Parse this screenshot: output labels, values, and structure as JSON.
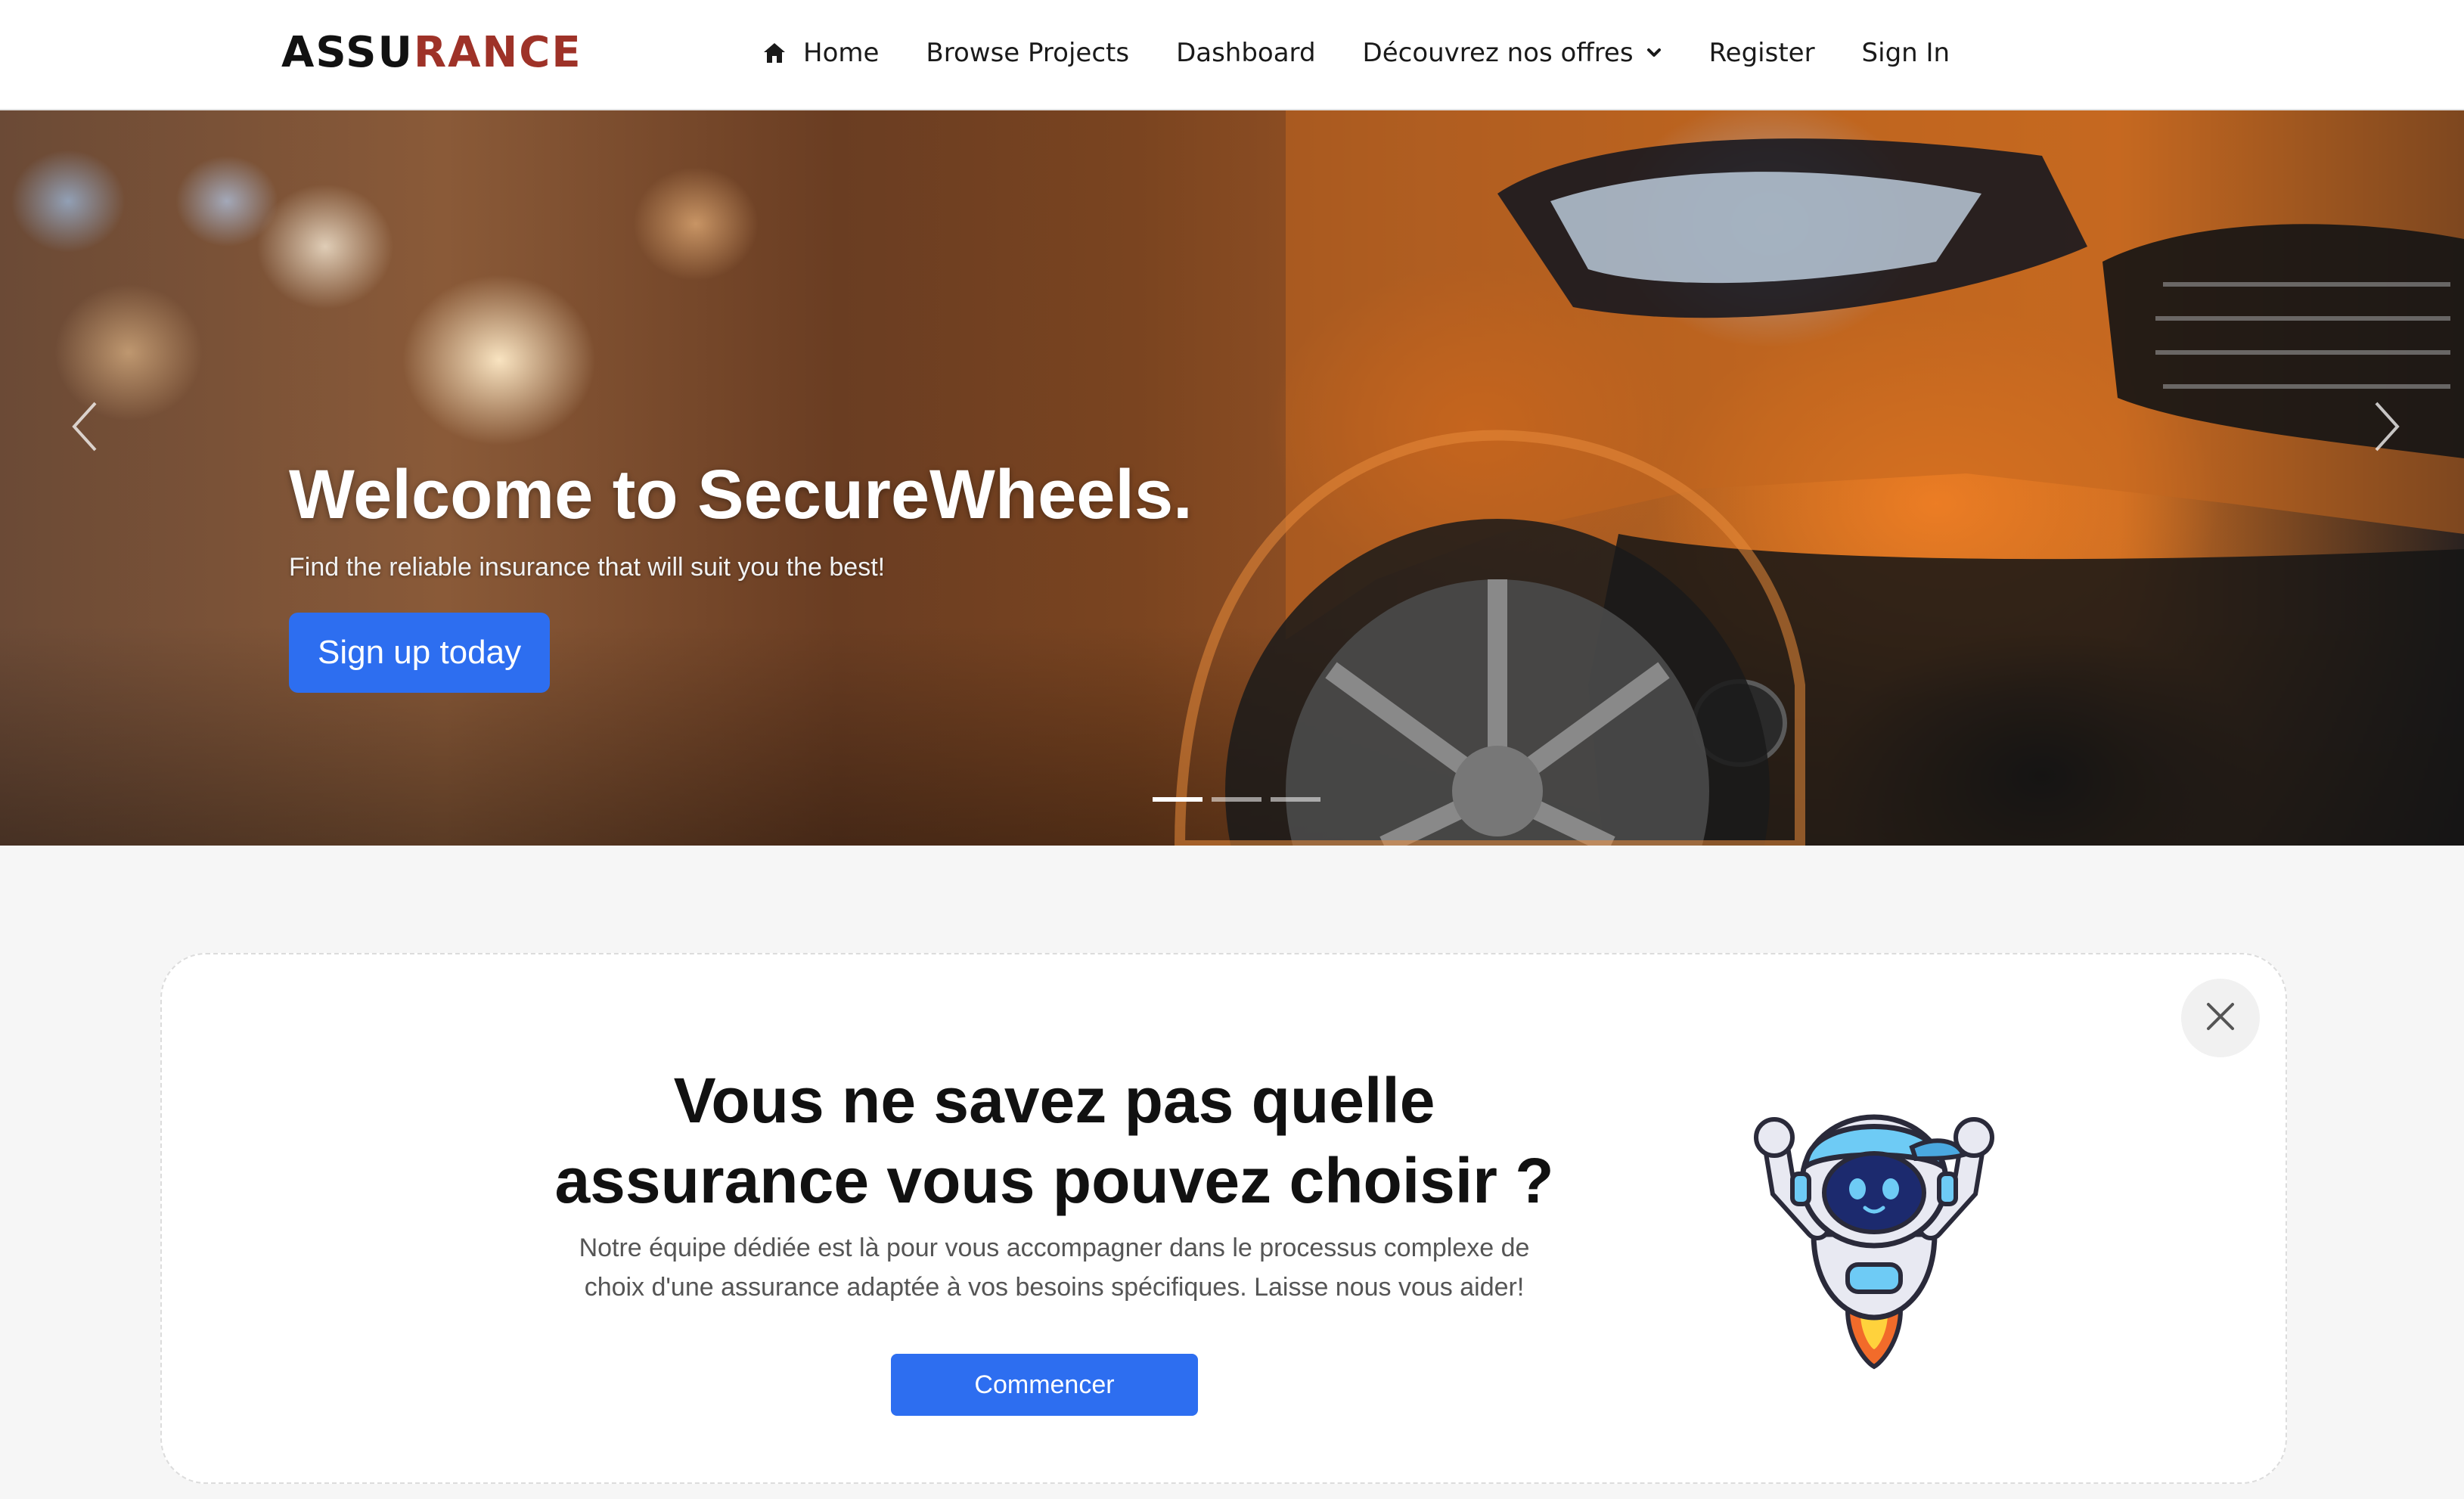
{
  "brand": {
    "part1": "ASSU",
    "part2": "RANCE",
    "color_primary": "#111111",
    "color_accent": "#9e3228"
  },
  "nav": {
    "items": [
      {
        "label": "Home",
        "icon": "home-icon"
      },
      {
        "label": "Browse Projects"
      },
      {
        "label": "Dashboard"
      },
      {
        "label": "Découvrez nos offres",
        "icon": "chevron-down-icon"
      },
      {
        "label": "Register"
      },
      {
        "label": "Sign In"
      }
    ]
  },
  "hero": {
    "title": "Welcome to SecureWheels.",
    "subtitle": "Find the reliable insurance that will suit you the best!",
    "cta_label": "Sign up today",
    "prev_icon": "chevron-left-icon",
    "next_icon": "chevron-right-icon",
    "slide_count": 3,
    "active_slide": 1
  },
  "help_card": {
    "title_line1": "Vous ne savez pas quelle",
    "title_line2": "assurance vous pouvez choisir ?",
    "description_line1": "Notre équipe dédiée est là pour vous accompagner dans le processus complexe de",
    "description_line2": "choix d'une assurance adaptée à vos besoins spécifiques. Laisse nous vous aider!",
    "button_label": "Commencer",
    "close_icon": "close-icon",
    "mascot_icon": "robot-mascot-icon"
  },
  "colors": {
    "primary_button": "#2d6ef0",
    "page_background": "#f6f6f6"
  }
}
